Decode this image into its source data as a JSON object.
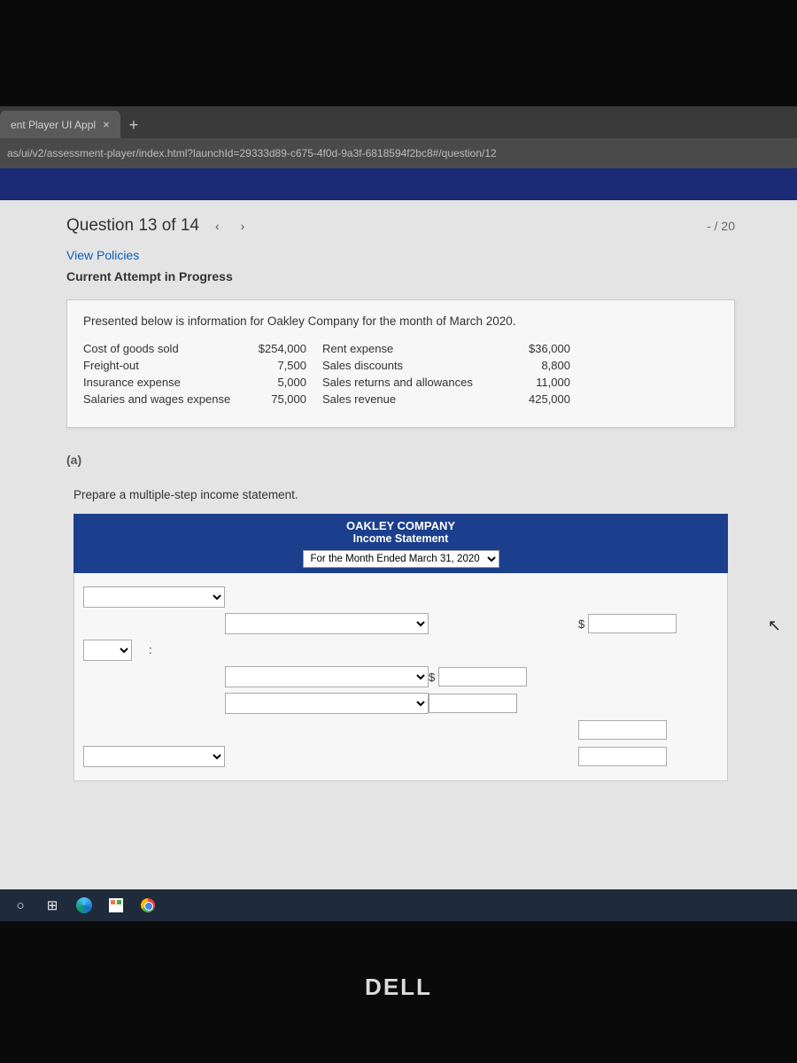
{
  "browser": {
    "tab_title": "ent Player UI Appl",
    "url": "as/ui/v2/assessment-player/index.html?launchId=29333d89-c675-4f0d-9a3f-6818594f2bc8#/question/12"
  },
  "header": {
    "question_label": "Question 13 of 14",
    "score": "- / 20",
    "view_policies": "View Policies",
    "attempt": "Current Attempt in Progress"
  },
  "info": {
    "intro": "Presented below is information for Oakley Company for the month of March 2020.",
    "rows": [
      {
        "l": "Cost of goods sold",
        "lv": "$254,000",
        "r": "Rent expense",
        "rv": "$36,000"
      },
      {
        "l": "Freight-out",
        "lv": "7,500",
        "r": "Sales discounts",
        "rv": "8,800"
      },
      {
        "l": "Insurance expense",
        "lv": "5,000",
        "r": "Sales returns and allowances",
        "rv": "11,000"
      },
      {
        "l": "Salaries and wages expense",
        "lv": "75,000",
        "r": "Sales revenue",
        "rv": "425,000"
      }
    ]
  },
  "part": "(a)",
  "instruction": "Prepare a multiple-step income statement.",
  "statement": {
    "company": "OAKLEY COMPANY",
    "title": "Income Statement",
    "date_option": "For the Month Ended March 31, 2020"
  },
  "brand": "DELL",
  "glyphs": {
    "close": "×",
    "plus": "+",
    "left": "‹",
    "right": "›",
    "dollar": "$",
    "colon": ":",
    "dropdown": "⌄",
    "cortana": "○",
    "taskview": "⊞"
  }
}
